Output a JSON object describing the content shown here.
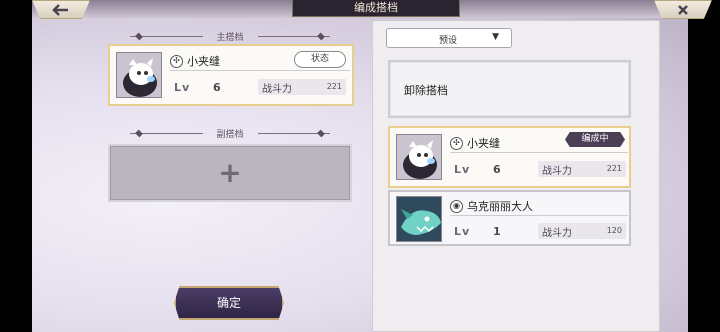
{
  "header": {
    "title": "编成搭档",
    "back_icon": "arrow-left-icon",
    "close_icon": "close-icon"
  },
  "main_partner": {
    "section_label": "主搭档",
    "name": "小夹缝",
    "element_icon": "element-icon",
    "status_button": "状态",
    "lv_label": "Lv",
    "level": "6",
    "power_label": "战斗力",
    "power": "221"
  },
  "sub_partner": {
    "section_label": "副搭档",
    "add_symbol": "+"
  },
  "confirm_label": "确定",
  "right_panel": {
    "preset_label": "预设",
    "preset_arrow": "▼",
    "unassign_label": "卸除搭档",
    "list": [
      {
        "name": "小夹缝",
        "lv_label": "Lv",
        "level": "6",
        "power_label": "战斗力",
        "power": "221",
        "badge": "编成中"
      },
      {
        "name": "乌克丽丽大人",
        "lv_label": "Lv",
        "level": "1",
        "power_label": "战斗力",
        "power": "120"
      }
    ]
  },
  "colors": {
    "accent_gold": "#e8cf8d",
    "badge_purple": "#4b3f56",
    "button_purple": "#2f2545"
  }
}
